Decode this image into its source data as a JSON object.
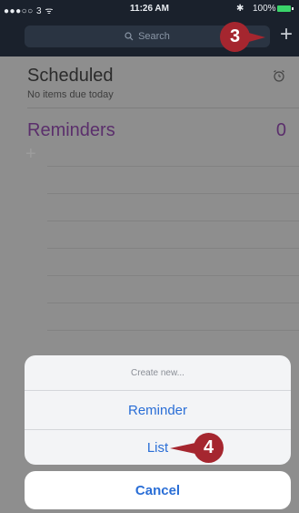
{
  "status_bar": {
    "carrier": "●●●○○ 3 ᯤ",
    "time": "11:26 AM",
    "bluetooth": "✱",
    "battery": "100%"
  },
  "header": {
    "search_placeholder": "Search",
    "add_symbol": "+"
  },
  "lists": {
    "scheduled": {
      "title": "Scheduled",
      "subtitle": "No items due today"
    },
    "reminders": {
      "title": "Reminders",
      "count": "0"
    },
    "new_item_symbol": "+"
  },
  "action_sheet": {
    "title": "Create new...",
    "options": [
      "Reminder",
      "List"
    ],
    "cancel": "Cancel"
  },
  "callouts": {
    "step3": "3",
    "step4": "4"
  },
  "colors": {
    "accent_blue": "#2a6ed6",
    "reminders_purple": "#5b2f6c",
    "callout_red": "#a5262f"
  }
}
